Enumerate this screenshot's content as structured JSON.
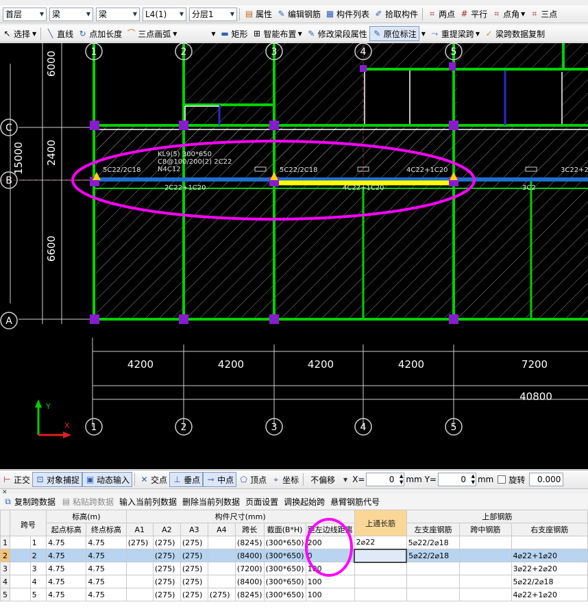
{
  "toolbar1": {
    "floor": "首层",
    "type": "梁",
    "subtype": "梁",
    "component": "L4(1)",
    "layer": "分层1",
    "buttons": [
      "属性",
      "编辑钢筋",
      "构件列表",
      "拾取构件",
      "两点",
      "平行",
      "点角",
      "三点"
    ]
  },
  "toolbar2": {
    "select": "选择",
    "buttons": [
      "直线",
      "点加长度",
      "三点画弧"
    ],
    "buttons2": [
      "矩形",
      "智能布置",
      "修改梁段属性",
      "原位标注",
      "重提梁跨",
      "梁跨数据复制"
    ]
  },
  "drawing": {
    "top_axes": [
      "1",
      "2",
      "3",
      "4",
      "5"
    ],
    "left_dims": [
      "6000",
      "2400",
      "6600"
    ],
    "total_left": "15000",
    "row_axes": [
      "C",
      "B",
      "A"
    ],
    "bottom_dims": [
      "4200",
      "4200",
      "4200",
      "4200",
      "7200"
    ],
    "total_bottom": "40800",
    "bottom_axes": [
      "1",
      "2",
      "3",
      "4",
      "5"
    ],
    "beam_label_1": "KL9(5) 300*650",
    "beam_label_2": "C8@100/200(2) 2C22",
    "beam_label_3": "N4C12",
    "rebar_labels": [
      "5C22/2C18",
      "5C22/2C18",
      "4C22+1C20",
      "3C22+2",
      "2C22+1C20",
      "4C22+1C20",
      "3C2"
    ],
    "colors": {
      "grid": "#00d000",
      "beam": "#1e6fd0",
      "selected": "#ffff00",
      "ellipse": "#ff00ff",
      "axis": "#ffffff"
    }
  },
  "snapbar": {
    "buttons": [
      "正交",
      "对象捕捉",
      "动态输入",
      "交点",
      "垂点",
      "中点",
      "顶点",
      "坐标"
    ],
    "offset": "不偏移",
    "x_label": "X=",
    "x_value": "0",
    "y_label": "mm Y=",
    "y_value": "0",
    "unit": "mm",
    "rotate": "旋转",
    "rotate_value": "0.000"
  },
  "gridbar": {
    "buttons": [
      "复制跨数据",
      "粘贴跨数据",
      "输入当前列数据",
      "删除当前列数据",
      "页面设置",
      "调换起始跨",
      "悬臂钢筋代号"
    ]
  },
  "table": {
    "h_span": "跨号",
    "h_elev": "标高(m)",
    "h_size": "构件尺寸(mm)",
    "h_top": "上通长筋",
    "h_upper": "上部钢筋",
    "sub": [
      "起点标高",
      "终点标高",
      "A1",
      "A2",
      "A3",
      "A4",
      "跨长",
      "截面(B*H)",
      "距左边线距离",
      "左支座钢筋",
      "跨中钢筋",
      "右支座钢筋"
    ],
    "rows": [
      [
        "1",
        "1",
        "4.75",
        "4.75",
        "(275)",
        "(275)",
        "(275)",
        "",
        "(8245)",
        "(300*650)",
        "200",
        "2⌀22",
        "5⌀22/2⌀18",
        "",
        ""
      ],
      [
        "2",
        "2",
        "4.75",
        "4.75",
        "",
        "(275)",
        "(275)",
        "",
        "(8400)",
        "(300*650)",
        "0",
        "",
        "5⌀22/2⌀18",
        "",
        "4⌀22+1⌀20"
      ],
      [
        "3",
        "3",
        "4.75",
        "4.75",
        "",
        "(275)",
        "(275)",
        "",
        "(7200)",
        "(300*650)",
        "100",
        "",
        "",
        "",
        "3⌀22+2⌀20"
      ],
      [
        "4",
        "4",
        "4.75",
        "4.75",
        "",
        "(275)",
        "(275)",
        "",
        "(8400)",
        "(300*650)",
        "100",
        "",
        "",
        "",
        "5⌀22/2⌀18"
      ],
      [
        "5",
        "5",
        "4.75",
        "4.75",
        "",
        "(275)",
        "(275)",
        "(275)",
        "(8245)",
        "(300*650)",
        "100",
        "",
        "",
        "",
        "4⌀22+1⌀20"
      ]
    ]
  }
}
